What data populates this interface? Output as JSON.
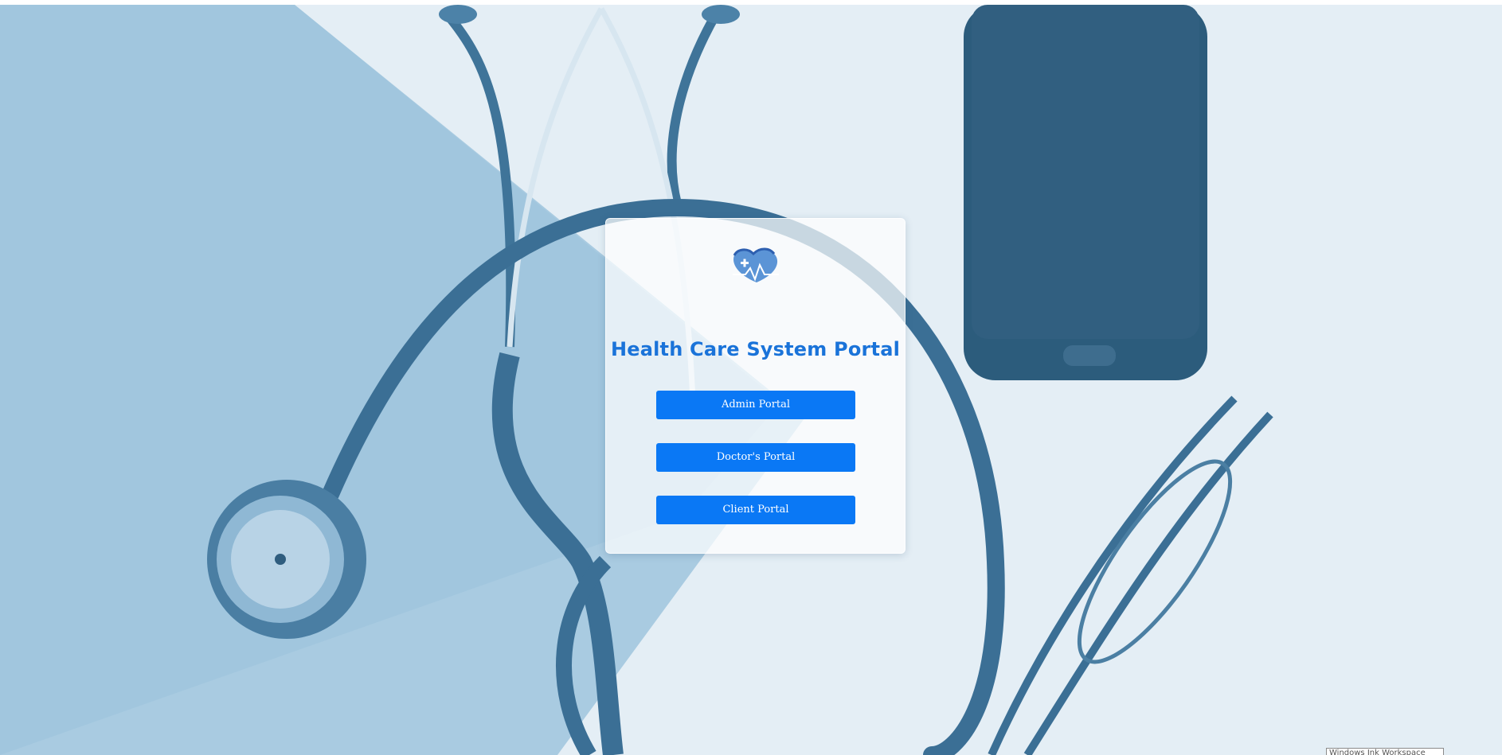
{
  "portal": {
    "title": "Health Care System Portal",
    "buttons": {
      "admin": "Admin Portal",
      "doctor": "Doctor's Portal",
      "client": "Client Portal"
    }
  },
  "overlay": {
    "corner_label": "Windows Ink Workspace"
  },
  "colors": {
    "accent": "#0a78f5",
    "title": "#1a73d9",
    "background_tint": "#7fb0d1"
  },
  "icons": {
    "logo": "heart-pulse-cross-icon"
  }
}
